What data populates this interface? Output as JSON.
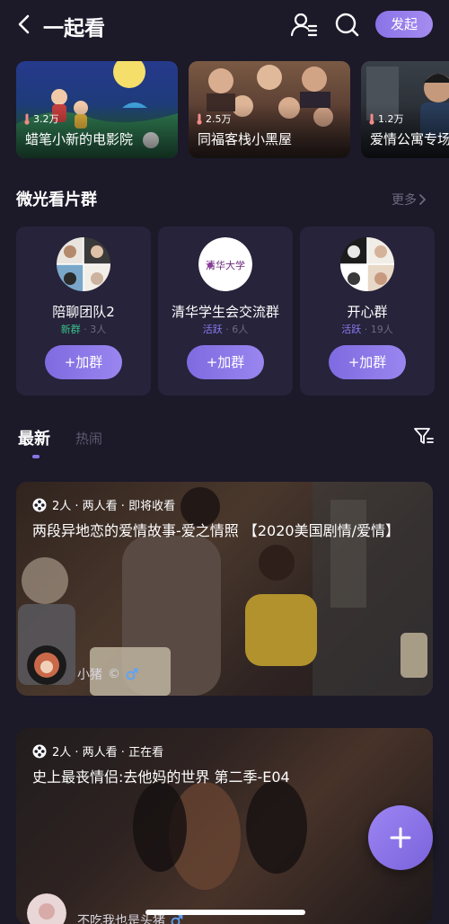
{
  "header": {
    "title": "一起看",
    "start_label": "发起"
  },
  "featured": [
    {
      "heat": "3.2万",
      "name": "蜡笔小新的电影院"
    },
    {
      "heat": "2.5万",
      "name": "同福客栈小黑屋"
    },
    {
      "heat": "1.2万",
      "name": "爱情公寓专场"
    }
  ],
  "groups_section": {
    "title": "微光看片群",
    "more_label": "更多"
  },
  "groups": [
    {
      "name": "陪聊团队2",
      "tag": "新群",
      "count": "3人",
      "join_label": "+加群"
    },
    {
      "name": "清华学生会交流群",
      "tag": "活跃",
      "count": "6人",
      "join_label": "+加群",
      "avatar_text": "清华大学"
    },
    {
      "name": "开心群",
      "tag": "活跃",
      "count": "19人",
      "join_label": "+加群"
    }
  ],
  "tabs": {
    "latest": "最新",
    "hot": "热闹"
  },
  "videos": [
    {
      "meta": "2人 · 两人看 · 即将收看",
      "title": "两段异地恋的爱情故事-爱之情照 【2020美国剧情/爱情】",
      "host": "小猪",
      "host_extra": "©"
    },
    {
      "meta": "2人 · 两人看 · 正在看",
      "title": "史上最丧情侣:去他妈的世界 第二季-E04",
      "host": "不吃我也是头猪"
    }
  ],
  "colors": {
    "background": "#1c1929",
    "card": "#26233a",
    "accent": "#8a73e6",
    "new_tag": "#37c08a",
    "active_tag": "#8a7af0"
  }
}
